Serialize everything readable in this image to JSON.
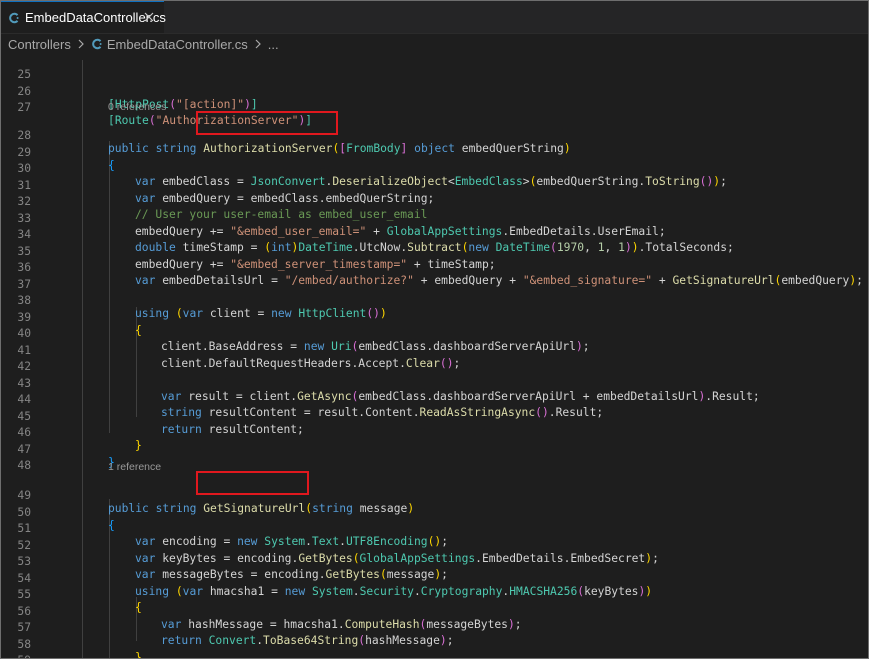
{
  "tab": {
    "label": "EmbedDataController.cs"
  },
  "breadcrumb": {
    "folder": "Controllers",
    "file": "EmbedDataController.cs",
    "more": "..."
  },
  "lens": {
    "ref0": "0 references",
    "ref1": "1 reference"
  },
  "colors": {
    "highlight_box": "#e0181e",
    "tab_accent": "#0e70c0",
    "cs_icon": "#519aba"
  },
  "line_numbers": [
    "25",
    "26",
    "27",
    "28",
    "29",
    "30",
    "31",
    "32",
    "33",
    "34",
    "35",
    "36",
    "37",
    "38",
    "39",
    "40",
    "41",
    "42",
    "43",
    "44",
    "45",
    "46",
    "47",
    "48",
    "49",
    "50",
    "51",
    "52",
    "53",
    "54",
    "55",
    "56",
    "57",
    "58",
    "59"
  ],
  "code": {
    "l26": {
      "b1": "[",
      "t1": "HttpPost",
      "b2": "(",
      "s1": "\"[action]\"",
      "b3": ")",
      "b4": "]"
    },
    "l27": {
      "b1": "[",
      "t1": "Route",
      "b2": "(",
      "s1": "\"AuthorizationServer\"",
      "b3": ")",
      "b4": "]"
    },
    "l28": {
      "k1": "public",
      "k2": "string",
      "f1": "AuthorizationServer",
      "b1": "(",
      "b2": "[",
      "t1": "FromBody",
      "b3": "]",
      "k3": "object",
      "v1": "embedQuerString",
      "b4": ")"
    },
    "l29": {
      "b1": "{"
    },
    "l30": {
      "k1": "var",
      "v1": "embedClass",
      "p1": "=",
      "t1": "JsonConvert",
      "p2": ".",
      "f1": "DeserializeObject",
      "p3": "<",
      "t2": "EmbedClass",
      "p4": ">",
      "b1": "(",
      "v2": "embedQuerString",
      "p5": ".",
      "f2": "ToString",
      "b2": "()",
      "b3": ")",
      "p6": ";"
    },
    "l31": {
      "k1": "var",
      "v1": "embedQuery",
      "p1": "=",
      "v2": "embedClass",
      "p2": ".",
      "v3": "embedQuerString",
      "p3": ";"
    },
    "l32": {
      "c1": "// User your user-email as embed_user_email"
    },
    "l33": {
      "v1": "embedQuery",
      "p1": "+=",
      "s1": "\"&embed_user_email=\"",
      "p2": "+",
      "t1": "GlobalAppSettings",
      "p3": ".",
      "v2": "EmbedDetails",
      "p4": ".",
      "v3": "UserEmail",
      "p5": ";"
    },
    "l34": {
      "k1": "double",
      "v1": "timeStamp",
      "p1": "=",
      "b1": "(",
      "k2": "int",
      "b2": ")",
      "t1": "DateTime",
      "p2": ".",
      "v2": "UtcNow",
      "p3": ".",
      "f1": "Subtract",
      "b3": "(",
      "k3": "new",
      "t2": "DateTime",
      "b4": "(",
      "n1": "1970",
      "p4": ",",
      "n2": "1",
      "p5": ",",
      "n3": "1",
      "b5": ")",
      "b6": ")",
      "p6": ".",
      "v3": "TotalSeconds",
      "p7": ";"
    },
    "l35": {
      "v1": "embedQuery",
      "p1": "+=",
      "s1": "\"&embed_server_timestamp=\"",
      "p2": "+",
      "v2": "timeStamp",
      "p3": ";"
    },
    "l36": {
      "k1": "var",
      "v1": "embedDetailsUrl",
      "p1": "=",
      "s1": "\"/embed/authorize?\"",
      "p2": "+",
      "v2": "embedQuery",
      "p3": "+",
      "s2": "\"&embed_signature=\"",
      "p4": "+",
      "f1": "GetSignatureUrl",
      "b1": "(",
      "v3": "embedQuery",
      "b2": ")",
      "p5": ";"
    },
    "l38": {
      "k1": "using",
      "b1": "(",
      "k2": "var",
      "v1": "client",
      "p1": "=",
      "k3": "new",
      "t1": "HttpClient",
      "b2": "()",
      "b3": ")"
    },
    "l39": {
      "b1": "{"
    },
    "l40": {
      "v1": "client",
      "p1": ".",
      "v2": "BaseAddress",
      "p2": "=",
      "k1": "new",
      "t1": "Uri",
      "b1": "(",
      "v3": "embedClass",
      "p3": ".",
      "v4": "dashboardServerApiUrl",
      "b2": ")",
      "p4": ";"
    },
    "l41": {
      "v1": "client",
      "p1": ".",
      "v2": "DefaultRequestHeaders",
      "p2": ".",
      "v3": "Accept",
      "p3": ".",
      "f1": "Clear",
      "b1": "()",
      "p4": ";"
    },
    "l43": {
      "k1": "var",
      "v1": "result",
      "p1": "=",
      "v2": "client",
      "p2": ".",
      "f1": "GetAsync",
      "b1": "(",
      "v3": "embedClass",
      "p3": ".",
      "v4": "dashboardServerApiUrl",
      "p4": "+",
      "v5": "embedDetailsUrl",
      "b2": ")",
      "p5": ".",
      "v6": "Result",
      "p6": ";"
    },
    "l44": {
      "k1": "string",
      "v1": "resultContent",
      "p1": "=",
      "v2": "result",
      "p2": ".",
      "v3": "Content",
      "p3": ".",
      "f1": "ReadAsStringAsync",
      "b1": "()",
      "p4": ".",
      "v4": "Result",
      "p5": ";"
    },
    "l45": {
      "k1": "return",
      "v1": "resultContent",
      "p1": ";"
    },
    "l46": {
      "b1": "}"
    },
    "l47": {
      "b1": "}"
    },
    "l49": {
      "k1": "public",
      "k2": "string",
      "f1": "GetSignatureUrl",
      "b1": "(",
      "k3": "string",
      "v1": "message",
      "b2": ")"
    },
    "l50": {
      "b1": "{"
    },
    "l51": {
      "k1": "var",
      "v1": "encoding",
      "p1": "=",
      "k2": "new",
      "t1": "System",
      "p2": ".",
      "t2": "Text",
      "p3": ".",
      "t3": "UTF8Encoding",
      "b1": "()",
      "p4": ";"
    },
    "l52": {
      "k1": "var",
      "v1": "keyBytes",
      "p1": "=",
      "v2": "encoding",
      "p2": ".",
      "f1": "GetBytes",
      "b1": "(",
      "t1": "GlobalAppSettings",
      "p3": ".",
      "v3": "EmbedDetails",
      "p4": ".",
      "v4": "EmbedSecret",
      "b2": ")",
      "p5": ";"
    },
    "l53": {
      "k1": "var",
      "v1": "messageBytes",
      "p1": "=",
      "v2": "encoding",
      "p2": ".",
      "f1": "GetBytes",
      "b1": "(",
      "v3": "message",
      "b2": ")",
      "p3": ";"
    },
    "l54": {
      "k1": "using",
      "b1": "(",
      "k2": "var",
      "v1": "hmacsha1",
      "p1": "=",
      "k3": "new",
      "t1": "System",
      "p2": ".",
      "t2": "Security",
      "p3": ".",
      "t3": "Cryptography",
      "p4": ".",
      "t4": "HMACSHA256",
      "b2": "(",
      "v2": "keyBytes",
      "b3": ")",
      "b4": ")"
    },
    "l55": {
      "b1": "{"
    },
    "l56": {
      "k1": "var",
      "v1": "hashMessage",
      "p1": "=",
      "v2": "hmacsha1",
      "p2": ".",
      "f1": "ComputeHash",
      "b1": "(",
      "v3": "messageBytes",
      "b2": ")",
      "p3": ";"
    },
    "l57": {
      "k1": "return",
      "t1": "Convert",
      "p1": ".",
      "f1": "ToBase64String",
      "b1": "(",
      "v1": "hashMessage",
      "b2": ")",
      "p2": ";"
    },
    "l58": {
      "b1": "}"
    },
    "l59": {
      "b1": "}"
    }
  }
}
